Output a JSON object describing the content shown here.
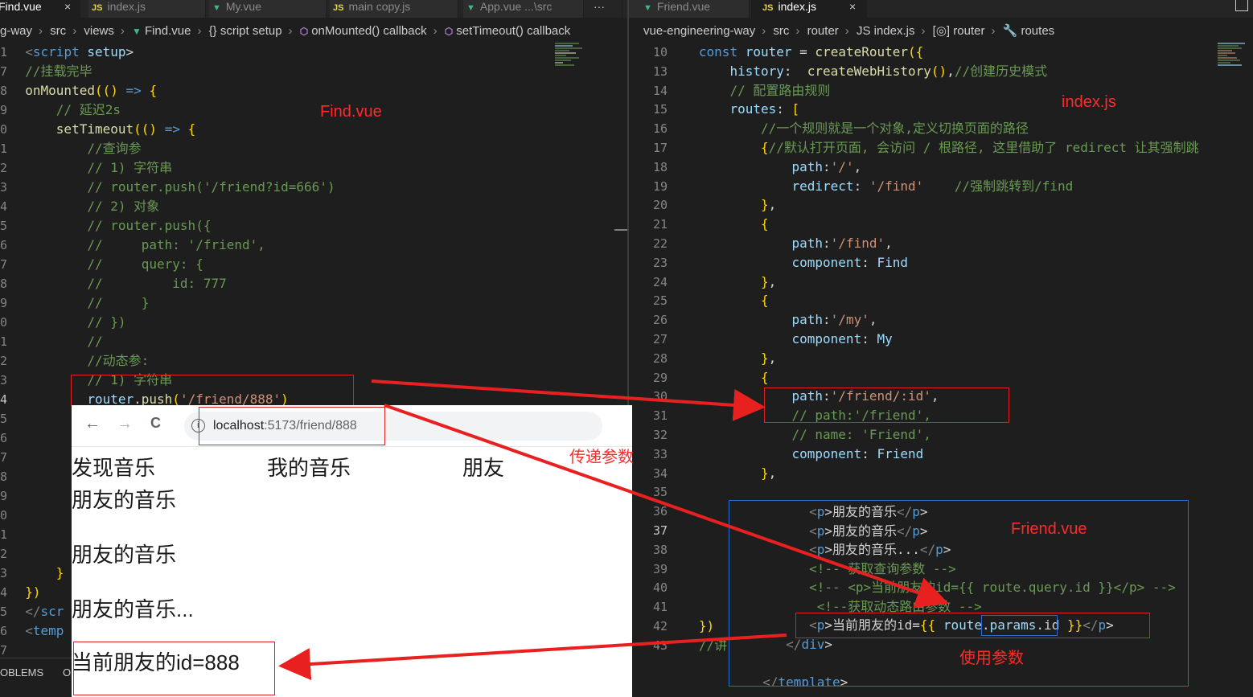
{
  "left": {
    "tabs": [
      {
        "icon": "vue",
        "label": "Find.vue"
      },
      {
        "icon": "js",
        "label": "index.js"
      },
      {
        "icon": "vue",
        "label": "My.vue"
      },
      {
        "icon": "js",
        "label": "main copy.js"
      },
      {
        "icon": "vue",
        "label": "App.vue ...\\src"
      }
    ],
    "more": "···",
    "close": "×",
    "breadcrumbs": [
      "g-way",
      "src",
      "views",
      "Find.vue",
      "{} script setup",
      "onMounted() callback",
      "setTimeout() callback"
    ],
    "lines": [
      {
        "n": "1",
        "t": "  <script setup>"
      },
      {
        "n": "7",
        "t": "  //挂载完毕"
      },
      {
        "n": "8",
        "t": "  onMounted(() => {"
      },
      {
        "n": "9",
        "t": "      // 延迟2s"
      },
      {
        "n": "0",
        "t": "      setTimeout(() => {"
      },
      {
        "n": "1",
        "t": "          //查询参"
      },
      {
        "n": "2",
        "t": "          // 1) 字符串"
      },
      {
        "n": "3",
        "t": "          // router.push('/friend?id=666')"
      },
      {
        "n": "4",
        "t": "          // 2) 对象"
      },
      {
        "n": "5",
        "t": "          // router.push({"
      },
      {
        "n": "6",
        "t": "          //     path: '/friend',"
      },
      {
        "n": "7",
        "t": "          //     query: {"
      },
      {
        "n": "8",
        "t": "          //         id: 777"
      },
      {
        "n": "9",
        "t": "          //     }"
      },
      {
        "n": "0",
        "t": "          // })"
      },
      {
        "n": "1",
        "t": "          //"
      },
      {
        "n": "2",
        "t": "          //动态参:"
      },
      {
        "n": "3",
        "t": "          // 1) 字符串"
      },
      {
        "n": "4",
        "t": "          router.push('/friend/888')"
      },
      {
        "n": "5",
        "t": ""
      },
      {
        "n": "6",
        "t": ""
      },
      {
        "n": "7",
        "t": ""
      },
      {
        "n": "8",
        "t": ""
      },
      {
        "n": "9",
        "t": ""
      },
      {
        "n": "0",
        "t": ""
      },
      {
        "n": "1",
        "t": ""
      },
      {
        "n": "2",
        "t": ""
      },
      {
        "n": "3",
        "t": "      }"
      },
      {
        "n": "4",
        "t": "  })"
      },
      {
        "n": "5",
        "t": "  </scr"
      },
      {
        "n": "6",
        "t": "  <temp"
      },
      {
        "n": "7",
        "t": ""
      }
    ],
    "annotation": "Find.vue",
    "bottom_tabs": [
      "OBLEMS",
      "O"
    ]
  },
  "right": {
    "tabs": [
      {
        "icon": "vue",
        "label": "Friend.vue"
      },
      {
        "icon": "js",
        "label": "index.js"
      }
    ],
    "close": "×",
    "breadcrumbs": [
      "vue-engineering-way",
      "src",
      "router",
      "JS index.js",
      "[◎] router",
      "🔧 routes"
    ],
    "lines": [
      {
        "n": "10",
        "t": "   const router = createRouter({"
      },
      {
        "n": "13",
        "t": "       history:  createWebHistory(),//创建历史模式"
      },
      {
        "n": "14",
        "t": "       // 配置路由规则"
      },
      {
        "n": "15",
        "t": "       routes: ["
      },
      {
        "n": "16",
        "t": "           //一个规则就是一个对象,定义切换页面的路径"
      },
      {
        "n": "17",
        "t": "           {//默认打开页面, 会访问 / 根路径, 这里借助了 redirect 让其强制跳"
      },
      {
        "n": "18",
        "t": "               path:'/',"
      },
      {
        "n": "19",
        "t": "               redirect: '/find'    //强制跳转到/find"
      },
      {
        "n": "20",
        "t": "           },"
      },
      {
        "n": "21",
        "t": "           {"
      },
      {
        "n": "22",
        "t": "               path:'/find',"
      },
      {
        "n": "23",
        "t": "               component: Find"
      },
      {
        "n": "24",
        "t": "           },"
      },
      {
        "n": "25",
        "t": "           {"
      },
      {
        "n": "26",
        "t": "               path:'/my',"
      },
      {
        "n": "27",
        "t": "               component: My"
      },
      {
        "n": "28",
        "t": "           },"
      },
      {
        "n": "29",
        "t": "           {"
      },
      {
        "n": "30",
        "t": "               path:'/friend/:id',"
      },
      {
        "n": "31",
        "t": "               // path:'/friend',"
      },
      {
        "n": "32",
        "t": "               // name: 'Friend',"
      },
      {
        "n": "33",
        "t": "               component: Friend"
      },
      {
        "n": "34",
        "t": "           },"
      },
      {
        "n": "35",
        "t": ""
      },
      {
        "n": "36",
        "t": ""
      },
      {
        "n": "37",
        "t": ""
      },
      {
        "n": "38",
        "t": ""
      },
      {
        "n": "39",
        "t": ""
      },
      {
        "n": "40",
        "t": ""
      },
      {
        "n": "41",
        "t": ""
      },
      {
        "n": "42",
        "t": "   })"
      },
      {
        "n": "43",
        "t": "   //讲"
      }
    ],
    "annotation": "index.js"
  },
  "friend_vue": {
    "annotation": "Friend.vue",
    "lines": [
      "        <p>朋友的音乐</p>",
      "        <p>朋友的音乐</p>",
      "        <p>朋友的音乐...</p>",
      "        <!-- 获取查询参数 -->",
      "        <!-- <p>当前朋友的id={{ route.query.id }}</p> -->",
      "         <!--获取动态路由参数 -->",
      "        <p>当前朋友的id={{ route.params.id }}</p>",
      "     </div>",
      "",
      "  </template>"
    ],
    "use_label": "使用参数"
  },
  "browser": {
    "back": "←",
    "forward": "→",
    "reload": "C",
    "info": "i",
    "url_host": "localhost",
    "url_rest": ":5173/friend/888",
    "nav": [
      "发现音乐",
      "我的音乐",
      "朋友"
    ],
    "paras": [
      "朋友的音乐",
      "朋友的音乐",
      "朋友的音乐...",
      "当前朋友的id=888"
    ],
    "pass_label": "传递参数"
  },
  "colors": {
    "annotation": "#ff2a2a",
    "editor_bg": "#1e1e1e",
    "highlight_border": "#2a6bd2"
  }
}
